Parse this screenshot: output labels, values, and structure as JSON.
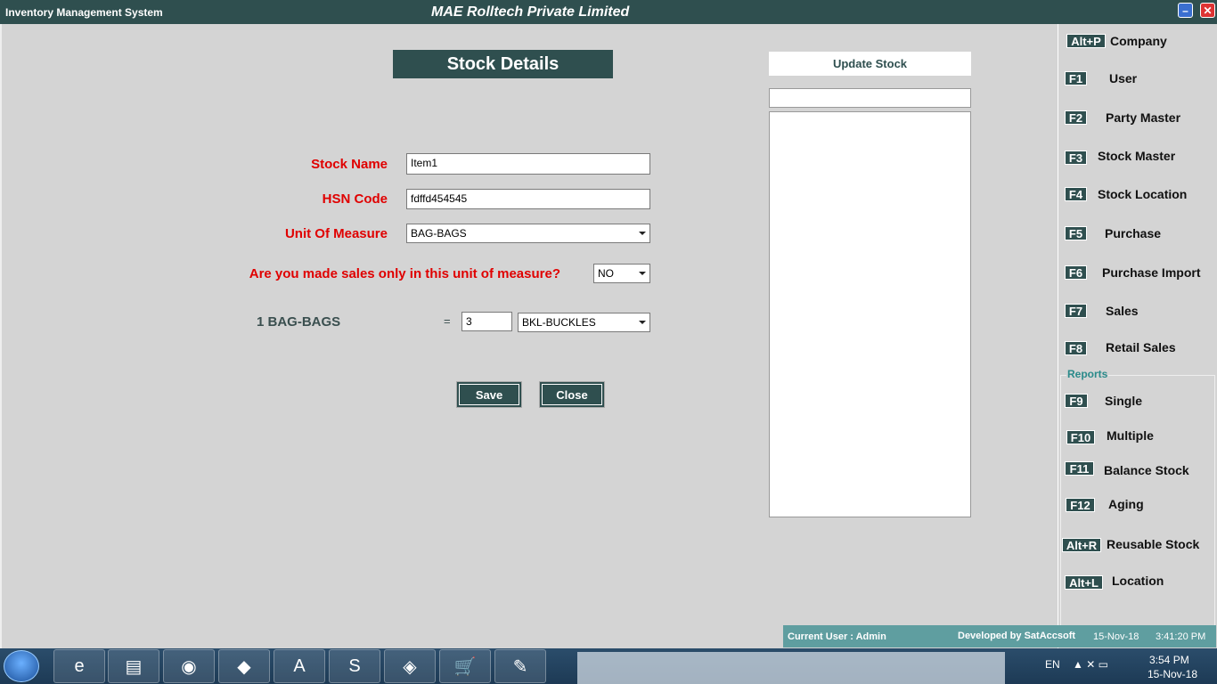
{
  "window": {
    "app_title": "Inventory Management System",
    "company_title": "MAE Rolltech Private Limited",
    "minimize_symbol": "–",
    "close_symbol": "✕"
  },
  "form": {
    "heading": "Stock Details",
    "stock_name_label": "Stock Name",
    "stock_name_value": "Item1",
    "hsn_label": "HSN Code",
    "hsn_value": "fdffd454545",
    "uom_label": "Unit Of Measure",
    "uom_value": "BAG-BAGS",
    "sales_only_label": "Are you made sales only in this unit of measure?",
    "sales_only_value": "NO",
    "conversion_label": "1 BAG-BAGS",
    "equals": "=",
    "conversion_qty": "3",
    "conversion_unit": "BKL-BUCKLES",
    "save_label": "Save",
    "close_label": "Close"
  },
  "update_panel": {
    "title": "Update Stock",
    "search_value": ""
  },
  "sidebar": {
    "items": [
      {
        "key": "Alt+P",
        "label": "Company"
      },
      {
        "key": "F1",
        "label": "User"
      },
      {
        "key": "F2",
        "label": "Party Master"
      },
      {
        "key": "F3",
        "label": "Stock Master"
      },
      {
        "key": "F4",
        "label": "Stock Location"
      },
      {
        "key": "F5",
        "label": "Purchase"
      },
      {
        "key": "F6",
        "label": "Purchase Import"
      },
      {
        "key": "F7",
        "label": "Sales"
      },
      {
        "key": "F8",
        "label": "Retail Sales"
      }
    ],
    "reports_label": "Reports",
    "report_items": [
      {
        "key": "F9",
        "label": "Single"
      },
      {
        "key": "F10",
        "label": "Multiple"
      },
      {
        "key": "F11",
        "label": "Balance Stock"
      },
      {
        "key": "F12",
        "label": "Aging"
      },
      {
        "key": "Alt+R",
        "label": "Reusable Stock"
      },
      {
        "key": "Alt+L",
        "label": "Location"
      }
    ]
  },
  "status": {
    "current_user": "Current User : Admin",
    "developer": "Developed by SatAccsoft",
    "date": "15-Nov-18",
    "time": "3:41:20 PM"
  },
  "taskbar": {
    "language": "EN",
    "tray_icons": "▲  ✕  ▭",
    "clock_time": "3:54 PM",
    "clock_date": "15-Nov-18",
    "apps": [
      "e",
      "▤",
      "◉",
      "◆",
      "A",
      "S",
      "◈",
      "🛒",
      "✎"
    ]
  },
  "colors": {
    "accent": "#2f4f4f",
    "label_red": "#e00000",
    "status_bar": "#5f9ea0"
  }
}
